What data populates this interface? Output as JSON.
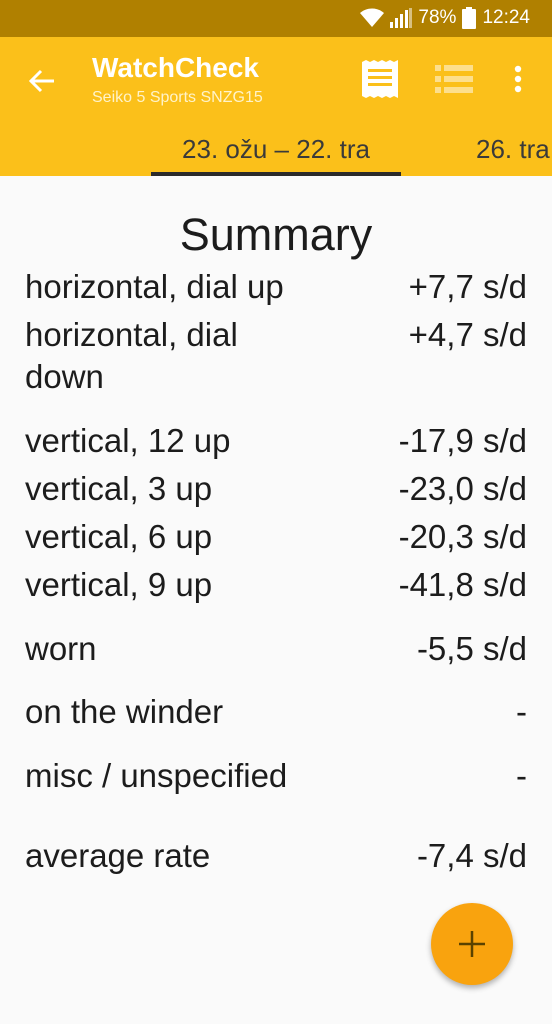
{
  "status_bar": {
    "battery": "78%",
    "time": "12:24",
    "icons": [
      "wifi-icon",
      "signal-icon",
      "battery-icon"
    ]
  },
  "app_bar": {
    "title": "WatchCheck",
    "subtitle": "Seiko 5 Sports SNZG15",
    "icons": [
      "back-arrow-icon",
      "notes-icon",
      "list-icon",
      "more-vert-icon"
    ]
  },
  "tabs": [
    {
      "label": "23. ožu – 22. tra",
      "active": true
    },
    {
      "label": "26. tra",
      "active": false
    }
  ],
  "summary": {
    "title": "Summary",
    "rows": [
      {
        "label": "horizontal, dial up",
        "value": "+7,7 s/d"
      },
      {
        "label": "horizontal, dial down",
        "value": "+4,7 s/d"
      },
      {
        "label": "vertical, 12 up",
        "value": "-17,9 s/d"
      },
      {
        "label": "vertical, 3 up",
        "value": "-23,0 s/d"
      },
      {
        "label": "vertical, 6 up",
        "value": "-20,3 s/d"
      },
      {
        "label": "vertical, 9 up",
        "value": "-41,8 s/d"
      },
      {
        "label": "worn",
        "value": "-5,5 s/d"
      },
      {
        "label": "on the winder",
        "value": "-"
      },
      {
        "label": "misc / unspecified",
        "value": "-"
      },
      {
        "label": "average rate",
        "value": "-7,4 s/d"
      }
    ]
  },
  "fab": {
    "icon": "add-icon"
  },
  "colors": {
    "status_bar": "#b08000",
    "app_bar": "#fbc01a",
    "fab": "#f9a30e",
    "background": "#fafafa"
  }
}
